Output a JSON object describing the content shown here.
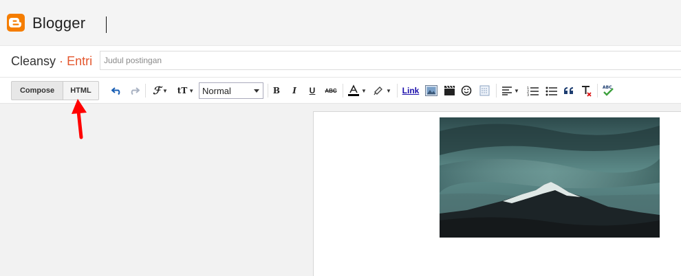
{
  "header": {
    "brand": "Blogger",
    "logo_icon": "blogger-logo-icon",
    "accent": "#f57d00"
  },
  "post": {
    "blog_name": "Cleansy",
    "separator": "·",
    "section": "Entri",
    "title_placeholder": "Judul postingan",
    "title_value": ""
  },
  "toolbar": {
    "compose_label": "Compose",
    "html_label": "HTML",
    "format_value": "Normal",
    "bold_label": "B",
    "italic_label": "I",
    "underline_label": "U",
    "strike_label": "ABC",
    "link_label": "Link",
    "spell_label": "ABC",
    "icons": [
      "undo-icon",
      "redo-icon",
      "font-family-icon",
      "font-size-icon",
      "text-color-icon",
      "highlight-icon",
      "image-icon",
      "video-icon",
      "emoji-icon",
      "jump-break-icon",
      "align-icon",
      "numbered-list-icon",
      "bullet-list-icon",
      "quote-icon",
      "clear-format-icon",
      "spellcheck-icon"
    ]
  },
  "annotation": {
    "arrow_color": "#ff0000"
  }
}
